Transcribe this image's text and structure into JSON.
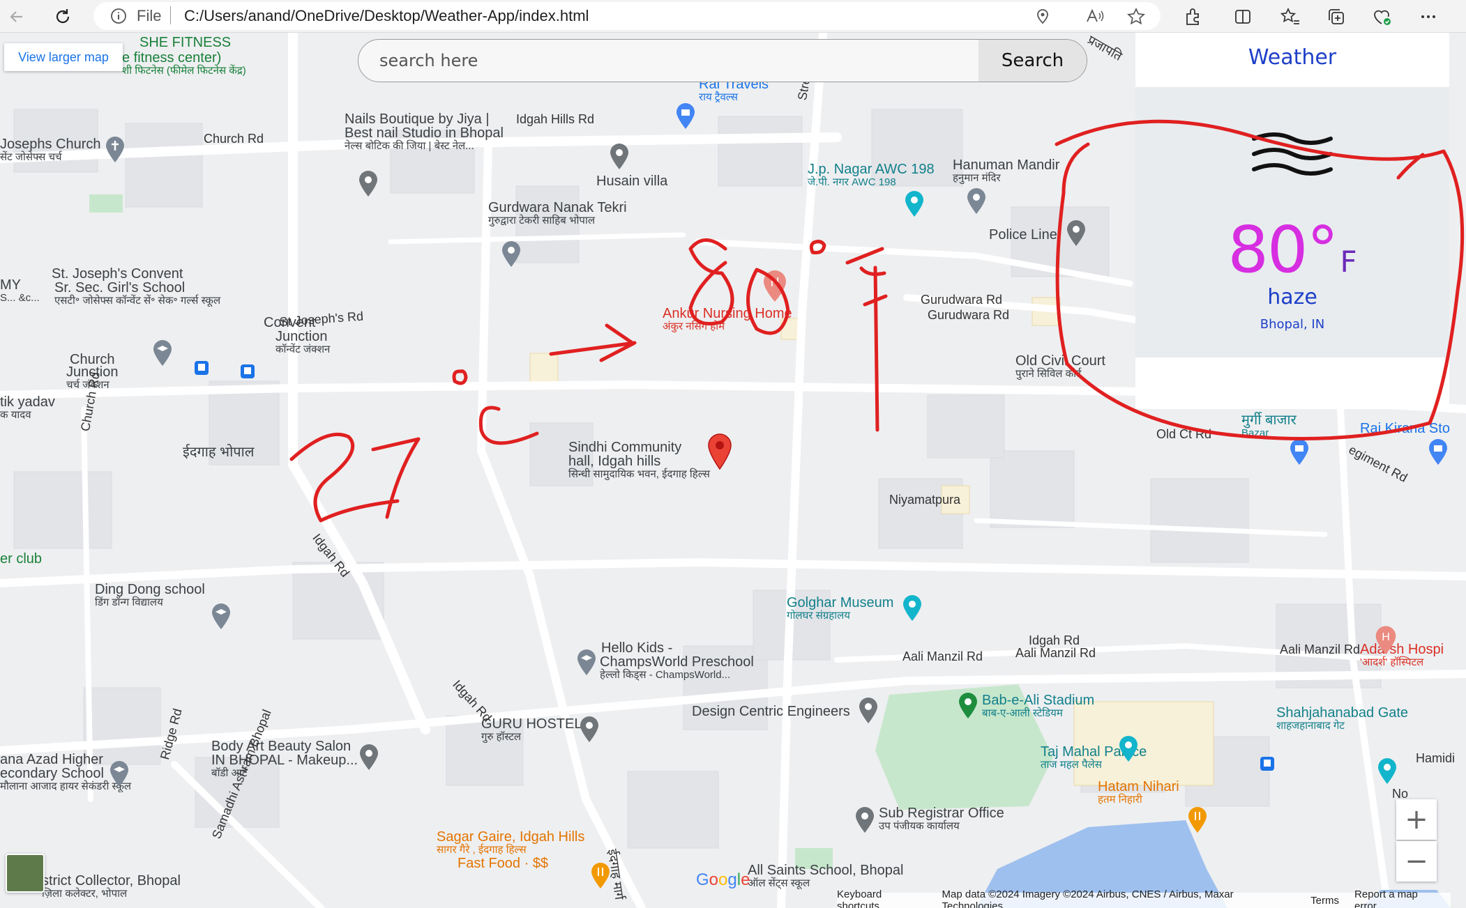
{
  "browser": {
    "file_label": "File",
    "url": "C:/Users/anand/OneDrive/Desktop/Weather-App/index.html"
  },
  "map": {
    "view_larger": "View larger map",
    "labels": [
      {
        "t": "SHE FITNESS",
        "s": "",
        "c": "green"
      },
      {
        "t": "e fitness center)",
        "s": "शी फिटनेस (फीमेल फिटनेस केंद्र)",
        "c": "green"
      },
      {
        "t": "Rai Travels",
        "s": "राय ट्रैवल्स",
        "c": "blue"
      },
      {
        "t": "Idgah Hills Rd",
        "s": "",
        "c": "road"
      },
      {
        "t": "Nails Boutique by Jiya |",
        "s": "",
        "c": "dark"
      },
      {
        "t": "Best nail Studio in Bhopal",
        "s": "नेल्स बोटिक की जिया | बेस्ट नेल...",
        "c": "dark"
      },
      {
        "t": "Josephs Church",
        "s": "सेंट जोसेफ्स चर्च",
        "c": "dark"
      },
      {
        "t": "Church Rd",
        "s": "",
        "c": "road"
      },
      {
        "t": "Husain villa",
        "s": "",
        "c": "dark"
      },
      {
        "t": "J.p. Nagar AWC 198",
        "s": "जे.पी. नगर AWC 198",
        "c": "teal"
      },
      {
        "t": "Hanuman Mandir",
        "s": "हनुमान मंदिर",
        "c": "dark"
      },
      {
        "t": "Gurdwara Nanak Tekri",
        "s": "गुरुद्वारा टेकरी साहिब भोपाल",
        "c": "dark"
      },
      {
        "t": "Police Line",
        "s": "",
        "c": "dark"
      },
      {
        "t": "St. Joseph's Convent",
        "s": "",
        "c": "dark"
      },
      {
        "t": "Sr. Sec. Girl's School",
        "s": "एसटी॰ जोसेफ्स कॉन्वेंट सें॰ सेक॰ गर्ल्स स्कूल",
        "c": "dark"
      },
      {
        "t": "Convent",
        "s": "",
        "c": "dark"
      },
      {
        "t": "Junction",
        "s": "कॉन्वेंट जंक्शन",
        "c": "dark"
      },
      {
        "t": "Ankur Nursing Home",
        "s": "अंकुर नर्सिंग होम",
        "c": "red"
      },
      {
        "t": "Gurudwara Rd",
        "s": "",
        "c": "road"
      },
      {
        "t": "Church",
        "s": "",
        "c": "dark"
      },
      {
        "t": "Junction",
        "s": "चर्च जंक्शन",
        "c": "dark"
      },
      {
        "t": "Old Civil Court",
        "s": "पुराने सिविल कोर्ट",
        "c": "dark"
      },
      {
        "t": "tik yadav",
        "s": "क यादव",
        "c": "dark"
      },
      {
        "t": "Old Ct Rd",
        "s": "",
        "c": "road"
      },
      {
        "t": "Rai Kirana Sto",
        "s": "",
        "c": "blue"
      },
      {
        "t": "मुर्गी बाजार",
        "s": "Bazar",
        "c": "teal"
      },
      {
        "t": "ईदगाह भोपाल",
        "s": "",
        "c": "dark"
      },
      {
        "t": "Sindhi Community",
        "s": "",
        "c": "dark"
      },
      {
        "t": "hall, Idgah hills",
        "s": "सिन्धी सामुदायिक भवन, ईदगाह हिल्स",
        "c": "dark"
      },
      {
        "t": "Niyamatpura",
        "s": "",
        "c": "road"
      },
      {
        "t": "er club",
        "s": "",
        "c": "green"
      },
      {
        "t": "Ding Dong school",
        "s": "डिंग डॉन्ग विद्यालय",
        "c": "dark"
      },
      {
        "t": "Golghar Museum",
        "s": "गोलघर संग्रहालय",
        "c": "teal"
      },
      {
        "t": "Hello Kids -",
        "s": "",
        "c": "dark"
      },
      {
        "t": "ChampsWorld Preschool",
        "s": "हेल्लो किड्स - ChampsWorld...",
        "c": "dark"
      },
      {
        "t": "Aali Manzil Rd",
        "s": "",
        "c": "road"
      },
      {
        "t": "Aali Manzil Rd",
        "s": "",
        "c": "road"
      },
      {
        "t": "Aali Manzil Rd",
        "s": "",
        "c": "road"
      },
      {
        "t": "Adarsh Hospi",
        "s": "'आदर्श' हॉस्पिटल",
        "c": "red"
      },
      {
        "t": "Design Centric Engineers",
        "s": "",
        "c": "dark"
      },
      {
        "t": "Bab-e-Ali Stadium",
        "s": "बाब-ए-आली स्टेडियम",
        "c": "teal"
      },
      {
        "t": "Shahjahanabad Gate",
        "s": "शाहजहानाबाद गेट",
        "c": "teal"
      },
      {
        "t": "GURU HOSTEL",
        "s": "गुरु हॉस्टल",
        "c": "dark"
      },
      {
        "t": "Taj Mahal Palace",
        "s": "ताज महल पैलेस",
        "c": "teal"
      },
      {
        "t": "Hamidi",
        "s": "",
        "c": "road"
      },
      {
        "t": "ana Azad Higher",
        "s": "",
        "c": "dark"
      },
      {
        "t": "econdary School",
        "s": "मौलाना आजाद हायर सेकंडरी स्कूल",
        "c": "dark"
      },
      {
        "t": "Body Art Beauty Salon",
        "s": "",
        "c": "dark"
      },
      {
        "t": "IN BHOPAL - Makeup...",
        "s": "बॉडी आर्ट",
        "c": "dark"
      },
      {
        "t": "Hatam Nihari",
        "s": "हतम निहारी",
        "c": "orange"
      },
      {
        "t": "Sub Registrar Office",
        "s": "उप पंजीयक कार्यालय",
        "c": "dark"
      },
      {
        "t": "Sagar Gaire, Idgah Hills",
        "s": "सागर गैरे , ईदगाह हिल्स",
        "c": "orange"
      },
      {
        "t": "Fast Food · $$",
        "s": "",
        "c": "orange"
      },
      {
        "t": "All Saints School, Bhopal",
        "s": "ऑल सेंट्स स्कूल",
        "c": "dark"
      },
      {
        "t": "strict Collector, Bhopal",
        "s": "ज़िला कलेक्टर, भोपाल",
        "c": "dark"
      },
      {
        "t": "Idgah Rd",
        "s": "",
        "c": "road"
      },
      {
        "t": "Idgah Rd",
        "s": "",
        "c": "road"
      },
      {
        "t": "Idgah Rd",
        "s": "",
        "c": "road"
      },
      {
        "t": "Gurudwara Rd",
        "s": "",
        "c": "road"
      },
      {
        "t": "St Joseph's Rd",
        "s": "",
        "c": "road"
      },
      {
        "t": "Church Rd",
        "s": "",
        "c": "road"
      },
      {
        "t": "Street",
        "s": "",
        "c": "road"
      },
      {
        "t": "Ridge Rd",
        "s": "",
        "c": "road"
      },
      {
        "t": "Samadhi Ashram Bhopal",
        "s": "",
        "c": "road"
      },
      {
        "t": "egiment Rd",
        "s": "",
        "c": "road"
      },
      {
        "t": "ईदगाह मार्ग",
        "s": "",
        "c": "road"
      },
      {
        "t": "प्रजापति",
        "s": "",
        "c": "road"
      },
      {
        "t": "MY",
        "s": "S... &c...",
        "c": "dark"
      },
      {
        "t": "No",
        "s": "",
        "c": "road"
      }
    ],
    "footer": {
      "shortcuts": "Keyboard shortcuts",
      "data": "Map data ©2024 Imagery ©2024 Airbus, CNES / Airbus, Maxar Technologies",
      "terms": "Terms",
      "report": "Report a map error"
    },
    "google_logo": "Google",
    "zoom_in": "+",
    "zoom_out": "−"
  },
  "search": {
    "placeholder": "search here",
    "button": "Search"
  },
  "weather": {
    "title": "Weather",
    "icon": "haze-icon",
    "temperature": "80°",
    "unit": "F",
    "condition": "haze",
    "location": "Bhopal, IN"
  },
  "colors": {
    "temperature": "#d62ee0",
    "unit": "#6a2bb8",
    "accent": "#1e3fc8",
    "annotation": "#e02020"
  }
}
